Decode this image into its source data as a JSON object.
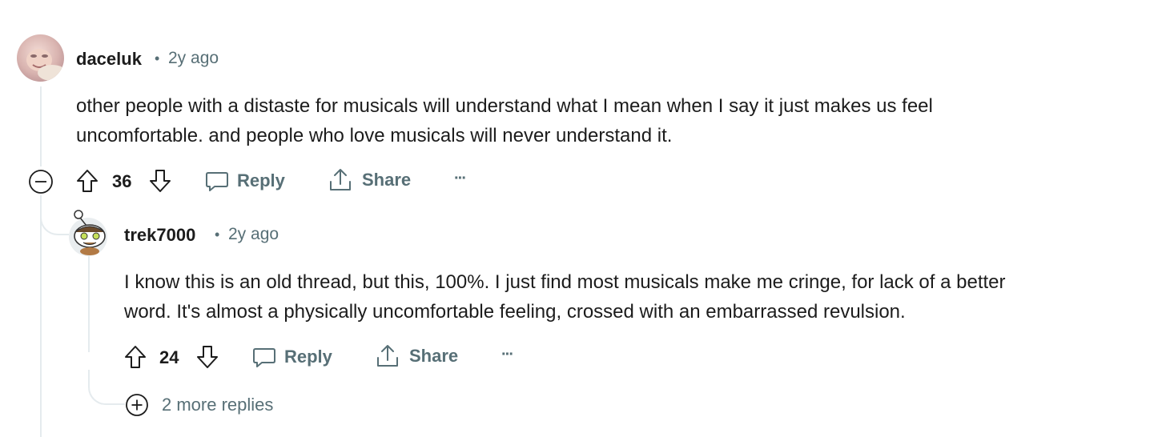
{
  "comment": {
    "username": "daceluk",
    "separator": "•",
    "time": "2y ago",
    "body_line1": "other people with a distaste for musicals will understand what I mean when I say it just makes us feel",
    "body_line2": "uncomfortable. and people who love musicals will never understand it.",
    "votes": "36",
    "reply_label": "Reply",
    "share_label": "Share",
    "more_label": "···",
    "avatar_icon": "user-photo-avatar",
    "collapse_icon": "minus-circle-icon"
  },
  "reply": {
    "username": "trek7000",
    "separator": "•",
    "time": "2y ago",
    "body_line1": "I know this is an old thread, but this, 100%. I just find most musicals make me cringe, for lack of a better",
    "body_line2": "word. It's almost a physically uncomfortable feeling, crossed with an embarrassed revulsion.",
    "votes": "24",
    "reply_label": "Reply",
    "share_label": "Share",
    "more_label": "···",
    "avatar_icon": "snoo-avatar"
  },
  "more_replies": {
    "label": "2 more replies",
    "icon": "plus-circle-icon"
  },
  "colors": {
    "meta_gray": "#576f76",
    "text_dark": "#1c1c1c",
    "thread_line": "#e5ebee"
  }
}
